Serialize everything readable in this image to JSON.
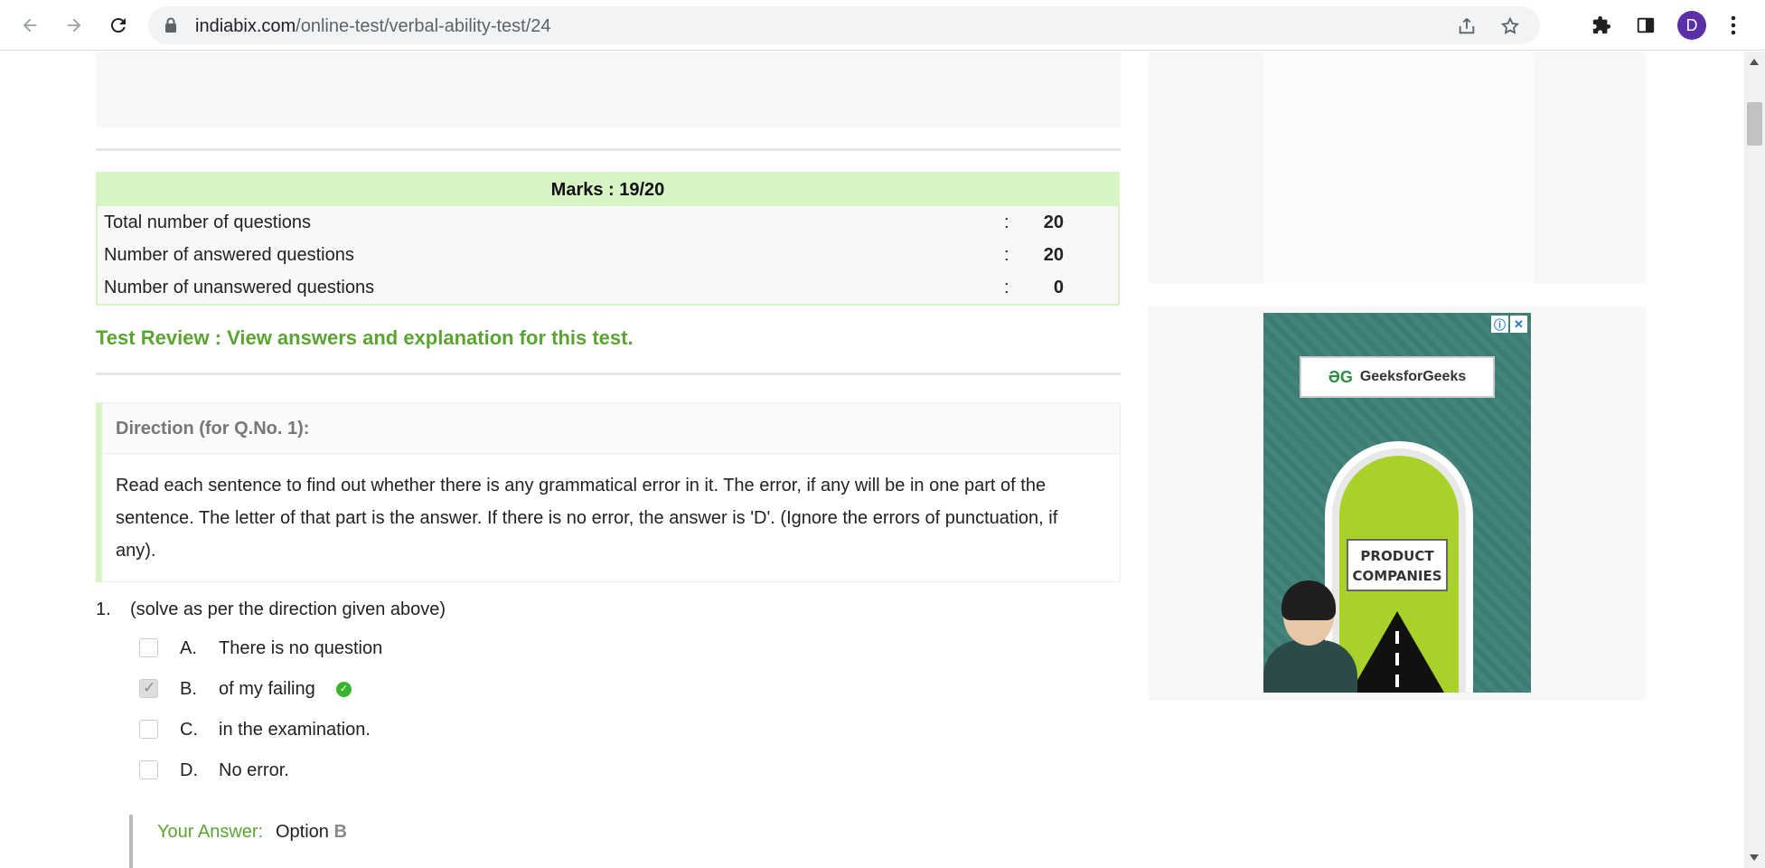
{
  "browser": {
    "url_domain": "indiabix.com",
    "url_path": "/online-test/verbal-ability-test/24",
    "avatar_letter": "D"
  },
  "marks": {
    "heading": "Marks : 19/20",
    "rows": [
      {
        "label": "Total number of questions",
        "colon": ":",
        "value": "20"
      },
      {
        "label": "Number of answered questions",
        "colon": ":",
        "value": "20"
      },
      {
        "label": "Number of unanswered questions",
        "colon": ":",
        "value": "0"
      }
    ]
  },
  "review_link": "Test Review : View answers and explanation for this test.",
  "direction": {
    "heading": "Direction (for Q.No. 1):",
    "text": "Read each sentence to find out whether there is any grammatical error in it. The error, if any will be in one part of the sentence. The letter of that part is the answer. If there is no error, the answer is 'D'. (Ignore the errors of punctuation, if any)."
  },
  "question": {
    "number": "1.",
    "text": "(solve as per the direction given above)",
    "options": [
      {
        "letter": "A.",
        "text": "There is no question",
        "checked": false
      },
      {
        "letter": "B.",
        "text": "of my failing",
        "checked": true,
        "correct": true
      },
      {
        "letter": "C.",
        "text": "in the examination.",
        "checked": false
      },
      {
        "letter": "D.",
        "text": "No error.",
        "checked": false
      }
    ],
    "answer_label": "Your Answer:",
    "answer_prefix": "Option",
    "answer_option": "B"
  },
  "ad": {
    "brand": "GeeksforGeeks",
    "sign_line1": "PRODUCT",
    "sign_line2": "COMPANIES"
  },
  "colors": {
    "accent_green": "#5aa532",
    "marks_bg": "#d7f5c4",
    "correct": "#3bb42d"
  }
}
